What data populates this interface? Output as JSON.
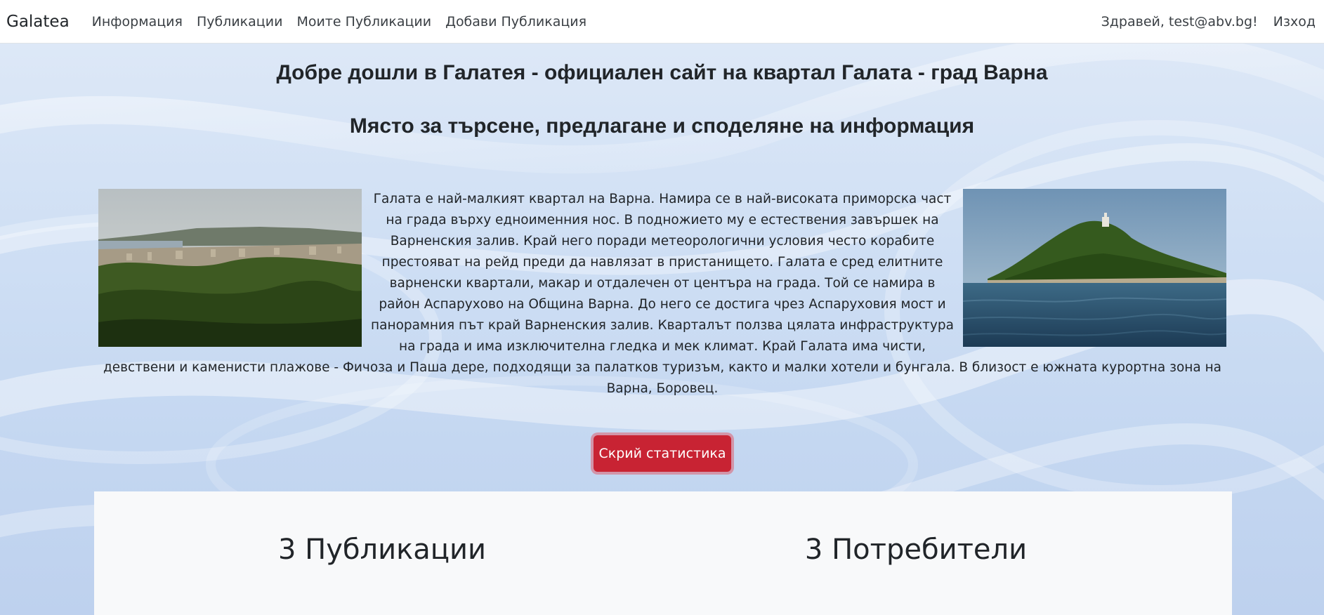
{
  "nav": {
    "brand": "Galatea",
    "links": [
      "Информация",
      "Публикации",
      "Моите Публикации",
      "Добави Публикация"
    ],
    "greeting": "Здравей, test@abv.bg!",
    "logout": "Изход"
  },
  "hero": {
    "title": "Добре дошли в Галатея - официален сайт на квартал Галата - град Варна",
    "subtitle": "Място за търсене, предлагане и споделяне на информация"
  },
  "content": {
    "description": "Галата е най-малкият квартал на Варна. Намира се в най-високата приморска част на града върху едноименния нос. В подножието му е естествения завършек на Варненския залив. Край него поради метеорологични условия често корабите престояват на рейд преди да навлязат в пристанището. Галата е сред елитните варненски квартали, макар и отдалечен от центъра на града. Той се намира в район Аспарухово на Община Варна. До него се достига чрез Аспаруховия мост и панорамния път край Варненския залив. Кварталът ползва цялата инфраструктура на града и има изключителна гледка и мек климат. Край Галата има чисти, девствени и каменисти плажове - Фичоза и Паша дере, подходящи за палатков туризъм, както и малки хотели и бунгала. В близост е южната курортна зона на Варна, Боровец."
  },
  "actions": {
    "toggle_stats": "Скрий статистика"
  },
  "stats": {
    "publications": "3 Публикации",
    "users": "3 Потребители"
  },
  "colors": {
    "danger": "#c82333",
    "stats_bg": "#f8f9fa"
  }
}
